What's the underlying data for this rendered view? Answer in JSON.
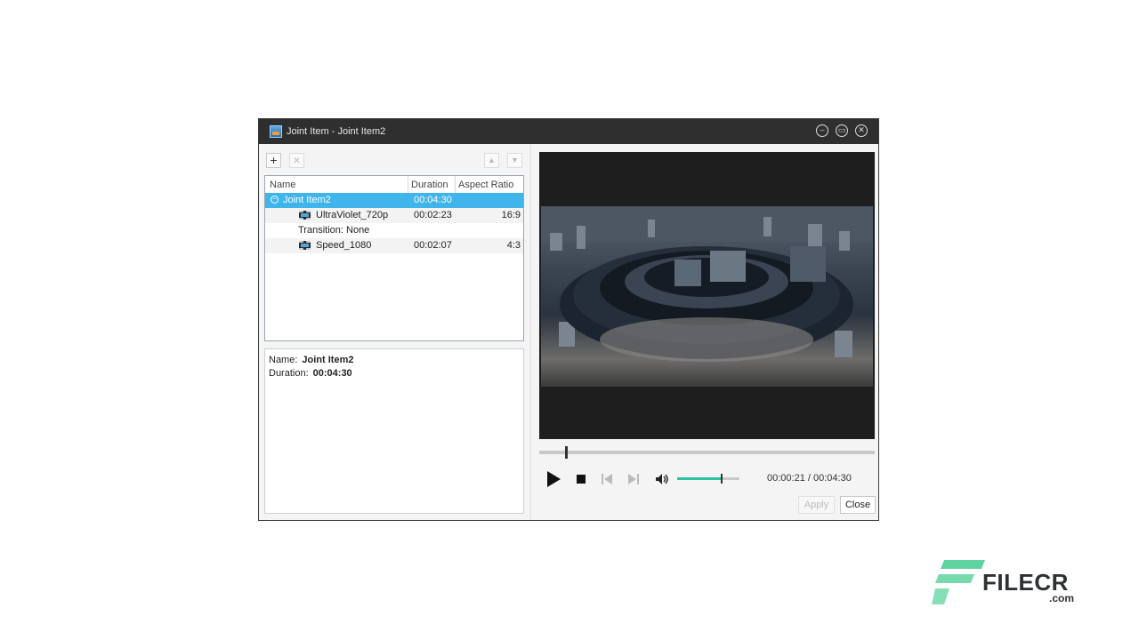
{
  "window": {
    "title": "Joint Item - Joint Item2",
    "controls": [
      "minimize-icon",
      "maximize-icon",
      "close-icon"
    ]
  },
  "toolbar": {
    "add_icon": "+",
    "remove_icon": "×",
    "up_icon": "▲",
    "down_icon": "▼"
  },
  "tree": {
    "columns": {
      "name": "Name",
      "duration": "Duration",
      "aspect": "Aspect Ratio"
    },
    "root": {
      "name": "Joint Item2",
      "duration": "00:04:30",
      "collapse_glyph": "−"
    },
    "items": [
      {
        "name": "UltraViolet_720p",
        "duration": "00:02:23",
        "aspect": "16:9"
      },
      {
        "transition": "Transition: None"
      },
      {
        "name": "Speed_1080",
        "duration": "00:02:07",
        "aspect": "4:3"
      }
    ]
  },
  "info": {
    "name_label": "Name:",
    "name_value": "Joint Item2",
    "duration_label": "Duration:",
    "duration_value": "00:04:30"
  },
  "player": {
    "seek_fraction": 0.078,
    "volume_fraction": 0.7,
    "current_time": "00:00:21",
    "total_time": "00:04:30",
    "time_separator": " / "
  },
  "buttons": {
    "apply": "Apply",
    "close": "Close"
  },
  "watermark": {
    "brand": "FILECR",
    "suffix": ".com"
  },
  "colors": {
    "selection": "#3fb5ec",
    "volume_fill": "#2fc1a0",
    "logo_green": "#5fd4a0"
  }
}
